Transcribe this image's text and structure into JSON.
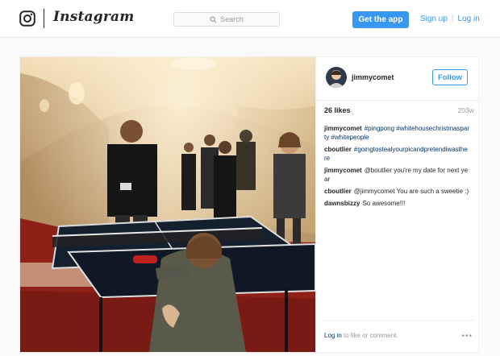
{
  "header": {
    "wordmark": "Instagram",
    "search_placeholder": "Search",
    "get_app_label": "Get the app",
    "sign_up_label": "Sign up",
    "separator": "|",
    "log_in_label": "Log in",
    "accent_color": "#3897f0"
  },
  "post": {
    "username": "jimmycomet",
    "follow_label": "Follow",
    "likes": "26 likes",
    "age": "203w",
    "comments": [
      {
        "user": "jimmycomet",
        "text": "#pingpong #whitehousechristmasparty #whitepeople",
        "is_tags": true
      },
      {
        "user": "cboutlier",
        "text": "#goingtostealyourpicandpretendiwasthere",
        "is_tags": true
      },
      {
        "user": "jimmycomet",
        "text": "@boutlier you're my date for next year",
        "is_tags": false
      },
      {
        "user": "cboutlier",
        "text": "@jimmycomet You are such a sweetie :)",
        "is_tags": false
      },
      {
        "user": "dawnsbizzy",
        "text": "So awesome!!!",
        "is_tags": false
      }
    ],
    "login_link": "Log in",
    "login_suffix": "to like or comment.",
    "more_label": "•••"
  }
}
